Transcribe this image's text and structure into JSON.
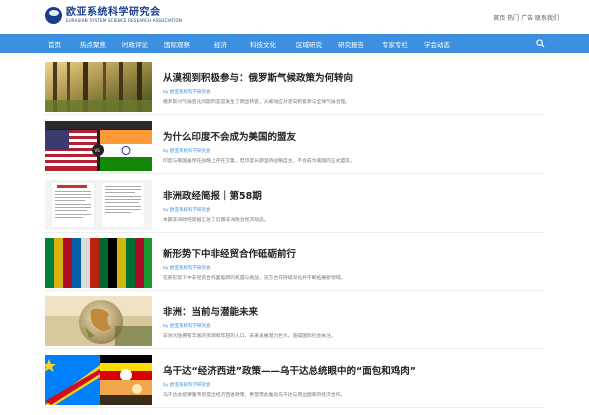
{
  "site": {
    "title": "欧亚系统科学研究会",
    "subtitle": "EURASIAN SYSTEM SCIENCE RESEARCH ASSOCIATION",
    "header_right": "首页  热门  广告  联系我们"
  },
  "nav": {
    "items": [
      "首页",
      "热点聚焦",
      "时政评论",
      "国际观察",
      "经济",
      "科技文化",
      "区域研究",
      "研究报告",
      "专家专栏",
      "学会动态"
    ]
  },
  "colors": {
    "nav_bg": "#3d8fe0",
    "meta": "#3d8fe0"
  },
  "articles": [
    {
      "title": "从漠视到积极参与：俄罗斯气候政策为何转向",
      "meta": "by 欧亚系统科学研究会",
      "excerpt": "俄罗斯对气候变化问题的态度发生了明显转变，从被动应对走向积极参与全球气候治理。"
    },
    {
      "title": "为什么印度不会成为美国的盟友",
      "meta": "by 欧亚系统科学研究会",
      "excerpt": "印度与美国虽然在战略上存在交集，但印度长期坚持战略自主，不会成为美国的正式盟友。"
    },
    {
      "title": "非洲政经简报｜第58期",
      "meta": "by 欧亚系统科学研究会",
      "excerpt": "本期非洲政经简报汇总了近期非洲政治经济动态。"
    },
    {
      "title": "新形势下中非经贸合作砥砺前行",
      "meta": "by 欧亚系统科学研究会",
      "excerpt": "在新形势下中非经贸合作面临新的机遇与挑战，双方合作持续深化并不断拓展新领域。"
    },
    {
      "title": "非洲：当前与潜能未来",
      "meta": "by 欧亚系统科学研究会",
      "excerpt": "非洲大陆拥有丰富的资源和年轻的人口，未来发展潜力巨大，值得国际社会关注。"
    },
    {
      "title": "乌干达“经济西进”政策——乌干达总统眼中的“面包和鸡肉”",
      "meta": "by 欧亚系统科学研究会",
      "excerpt": "乌干达总统穆塞韦尼提出经济西进政策，希望借此推动乌干达与周边国家的经济合作。"
    }
  ]
}
